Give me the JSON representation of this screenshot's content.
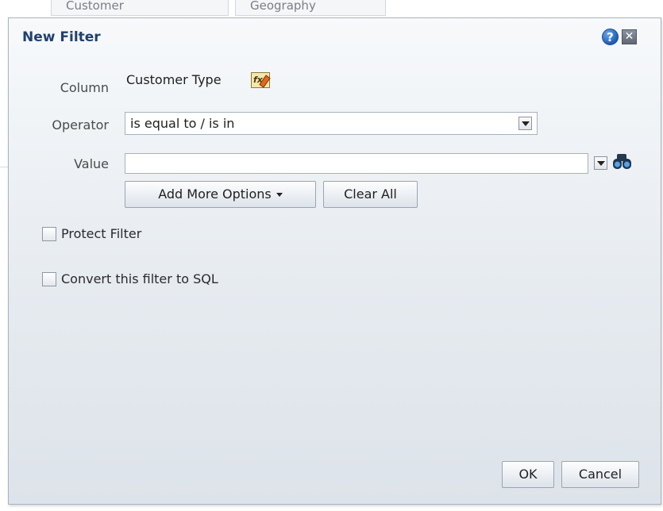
{
  "background": {
    "tab1_label": "Customer",
    "tab2_label": "Geography"
  },
  "dialog": {
    "title": "New Filter",
    "help_glyph": "?",
    "close_glyph": "✕",
    "icons": {
      "help": "help-icon",
      "close": "close-icon",
      "edit_column": "edit-column-formula-icon",
      "search": "binoculars-icon"
    }
  },
  "form": {
    "column_label": "Column",
    "column_value": "Customer Type",
    "edit_icon_text": "fx",
    "operator_label": "Operator",
    "operator_value": "is equal to / is in",
    "value_label": "Value",
    "value_input": "",
    "add_more_options": "Add More Options",
    "clear_all": "Clear All"
  },
  "options": {
    "protect_filter": "Protect Filter",
    "protect_filter_checked": false,
    "convert_sql": "Convert this filter to SQL",
    "convert_sql_checked": false
  },
  "footer": {
    "ok": "OK",
    "cancel": "Cancel"
  },
  "colors": {
    "title": "#21416c",
    "dialog_border": "#a9b3bf",
    "accent_blue": "#1c5db5"
  }
}
